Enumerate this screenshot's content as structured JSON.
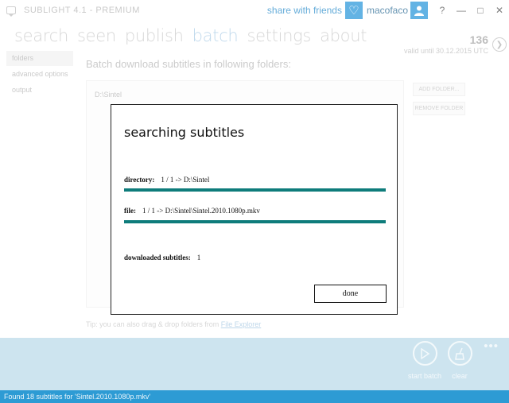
{
  "window": {
    "title": "SUBLIGHT 4.1 - PREMIUM",
    "share_label": "share with friends",
    "username": "macofaco",
    "help": "?",
    "minimize": "—",
    "maximize": "□",
    "close": "✕"
  },
  "nav": {
    "items": [
      {
        "label": "search",
        "active": false
      },
      {
        "label": "seen",
        "active": false
      },
      {
        "label": "publish",
        "active": false
      },
      {
        "label": "batch",
        "active": true
      },
      {
        "label": "settings",
        "active": false
      },
      {
        "label": "about",
        "active": false
      }
    ],
    "count": "136",
    "valid_until": "valid until 30.12.2015 UTC"
  },
  "sidebar": {
    "items": [
      {
        "label": "folders",
        "active": true
      },
      {
        "label": "advanced options",
        "active": false
      },
      {
        "label": "output",
        "active": false
      }
    ]
  },
  "main": {
    "heading": "Batch download subtitles in following folders:",
    "folders": [
      "D:\\Sintel"
    ],
    "add_folder": "ADD FOLDER...",
    "remove_folder": "REMOVE FOLDER",
    "tip_prefix": "Tip: you can also drag & drop folders from ",
    "tip_link": "File Explorer"
  },
  "dialog": {
    "title": "searching subtitles",
    "directory_label": "directory:",
    "directory_value": "1 / 1 -> D:\\Sintel",
    "directory_progress": 1.0,
    "file_label": "file:",
    "file_value": "1 / 1 -> D:\\Sintel\\Sintel.2010.1080p.mkv",
    "file_progress": 1.0,
    "downloaded_label": "downloaded subtitles:",
    "downloaded_value": "1",
    "done_label": "done"
  },
  "bottom": {
    "start_batch": "start batch",
    "clear": "clear",
    "more": "•••"
  },
  "status": {
    "text": "Found 18 subtitles for 'Sintel.2010.1080p.mkv'"
  },
  "colors": {
    "accent": "#1a8fd8",
    "progress": "#0e7c7b",
    "bottom_bar": "#b5d7e8",
    "status_bar": "#2d9bd4"
  }
}
